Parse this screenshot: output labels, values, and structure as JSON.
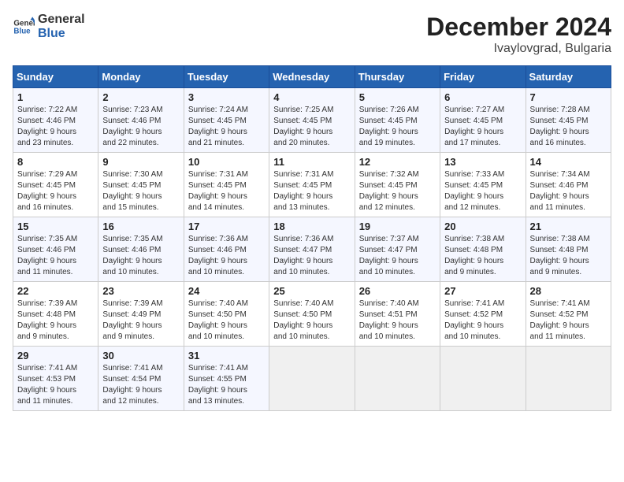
{
  "header": {
    "logo_line1": "General",
    "logo_line2": "Blue",
    "title": "December 2024",
    "subtitle": "Ivaylovgrad, Bulgaria"
  },
  "days_of_week": [
    "Sunday",
    "Monday",
    "Tuesday",
    "Wednesday",
    "Thursday",
    "Friday",
    "Saturday"
  ],
  "weeks": [
    [
      {
        "day": "1",
        "info": "Sunrise: 7:22 AM\nSunset: 4:46 PM\nDaylight: 9 hours\nand 23 minutes."
      },
      {
        "day": "2",
        "info": "Sunrise: 7:23 AM\nSunset: 4:46 PM\nDaylight: 9 hours\nand 22 minutes."
      },
      {
        "day": "3",
        "info": "Sunrise: 7:24 AM\nSunset: 4:45 PM\nDaylight: 9 hours\nand 21 minutes."
      },
      {
        "day": "4",
        "info": "Sunrise: 7:25 AM\nSunset: 4:45 PM\nDaylight: 9 hours\nand 20 minutes."
      },
      {
        "day": "5",
        "info": "Sunrise: 7:26 AM\nSunset: 4:45 PM\nDaylight: 9 hours\nand 19 minutes."
      },
      {
        "day": "6",
        "info": "Sunrise: 7:27 AM\nSunset: 4:45 PM\nDaylight: 9 hours\nand 17 minutes."
      },
      {
        "day": "7",
        "info": "Sunrise: 7:28 AM\nSunset: 4:45 PM\nDaylight: 9 hours\nand 16 minutes."
      }
    ],
    [
      {
        "day": "8",
        "info": "Sunrise: 7:29 AM\nSunset: 4:45 PM\nDaylight: 9 hours\nand 16 minutes."
      },
      {
        "day": "9",
        "info": "Sunrise: 7:30 AM\nSunset: 4:45 PM\nDaylight: 9 hours\nand 15 minutes."
      },
      {
        "day": "10",
        "info": "Sunrise: 7:31 AM\nSunset: 4:45 PM\nDaylight: 9 hours\nand 14 minutes."
      },
      {
        "day": "11",
        "info": "Sunrise: 7:31 AM\nSunset: 4:45 PM\nDaylight: 9 hours\nand 13 minutes."
      },
      {
        "day": "12",
        "info": "Sunrise: 7:32 AM\nSunset: 4:45 PM\nDaylight: 9 hours\nand 12 minutes."
      },
      {
        "day": "13",
        "info": "Sunrise: 7:33 AM\nSunset: 4:45 PM\nDaylight: 9 hours\nand 12 minutes."
      },
      {
        "day": "14",
        "info": "Sunrise: 7:34 AM\nSunset: 4:46 PM\nDaylight: 9 hours\nand 11 minutes."
      }
    ],
    [
      {
        "day": "15",
        "info": "Sunrise: 7:35 AM\nSunset: 4:46 PM\nDaylight: 9 hours\nand 11 minutes."
      },
      {
        "day": "16",
        "info": "Sunrise: 7:35 AM\nSunset: 4:46 PM\nDaylight: 9 hours\nand 10 minutes."
      },
      {
        "day": "17",
        "info": "Sunrise: 7:36 AM\nSunset: 4:46 PM\nDaylight: 9 hours\nand 10 minutes."
      },
      {
        "day": "18",
        "info": "Sunrise: 7:36 AM\nSunset: 4:47 PM\nDaylight: 9 hours\nand 10 minutes."
      },
      {
        "day": "19",
        "info": "Sunrise: 7:37 AM\nSunset: 4:47 PM\nDaylight: 9 hours\nand 10 minutes."
      },
      {
        "day": "20",
        "info": "Sunrise: 7:38 AM\nSunset: 4:48 PM\nDaylight: 9 hours\nand 9 minutes."
      },
      {
        "day": "21",
        "info": "Sunrise: 7:38 AM\nSunset: 4:48 PM\nDaylight: 9 hours\nand 9 minutes."
      }
    ],
    [
      {
        "day": "22",
        "info": "Sunrise: 7:39 AM\nSunset: 4:48 PM\nDaylight: 9 hours\nand 9 minutes."
      },
      {
        "day": "23",
        "info": "Sunrise: 7:39 AM\nSunset: 4:49 PM\nDaylight: 9 hours\nand 9 minutes."
      },
      {
        "day": "24",
        "info": "Sunrise: 7:40 AM\nSunset: 4:50 PM\nDaylight: 9 hours\nand 10 minutes."
      },
      {
        "day": "25",
        "info": "Sunrise: 7:40 AM\nSunset: 4:50 PM\nDaylight: 9 hours\nand 10 minutes."
      },
      {
        "day": "26",
        "info": "Sunrise: 7:40 AM\nSunset: 4:51 PM\nDaylight: 9 hours\nand 10 minutes."
      },
      {
        "day": "27",
        "info": "Sunrise: 7:41 AM\nSunset: 4:52 PM\nDaylight: 9 hours\nand 10 minutes."
      },
      {
        "day": "28",
        "info": "Sunrise: 7:41 AM\nSunset: 4:52 PM\nDaylight: 9 hours\nand 11 minutes."
      }
    ],
    [
      {
        "day": "29",
        "info": "Sunrise: 7:41 AM\nSunset: 4:53 PM\nDaylight: 9 hours\nand 11 minutes."
      },
      {
        "day": "30",
        "info": "Sunrise: 7:41 AM\nSunset: 4:54 PM\nDaylight: 9 hours\nand 12 minutes."
      },
      {
        "day": "31",
        "info": "Sunrise: 7:41 AM\nSunset: 4:55 PM\nDaylight: 9 hours\nand 13 minutes."
      },
      {
        "day": "",
        "info": ""
      },
      {
        "day": "",
        "info": ""
      },
      {
        "day": "",
        "info": ""
      },
      {
        "day": "",
        "info": ""
      }
    ]
  ]
}
